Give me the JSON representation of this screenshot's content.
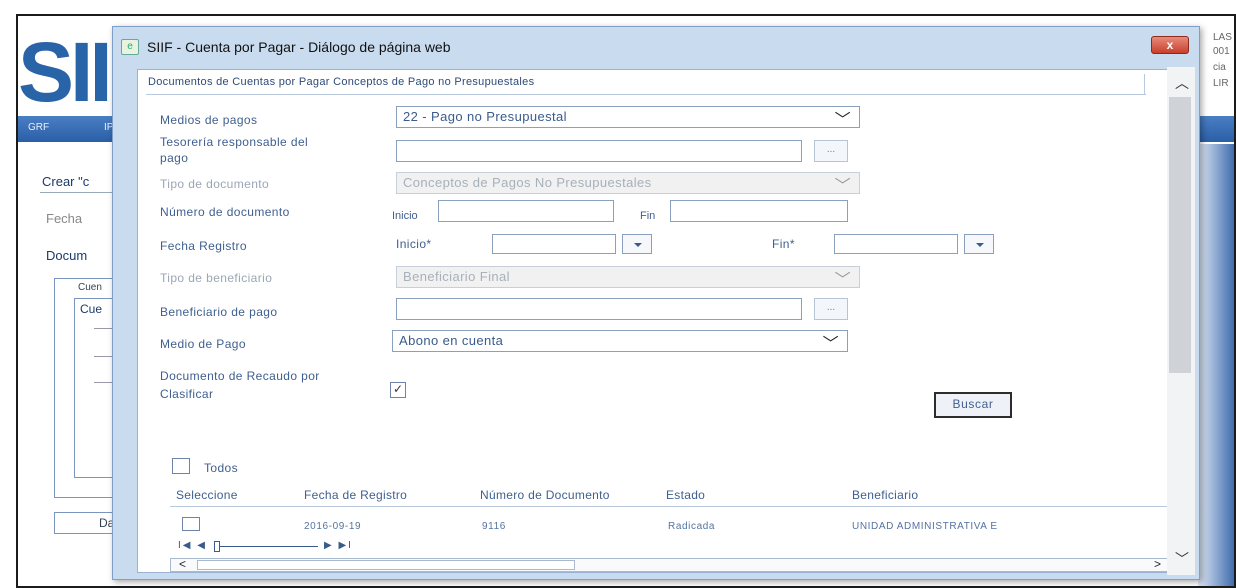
{
  "background": {
    "logo": "SII",
    "nav_items": [
      "GRF",
      "IP"
    ],
    "right_fragments": [
      "LAS",
      "001",
      "cia",
      "LIR"
    ],
    "crear_text": "Crear \"c",
    "fecha_text": "Fecha",
    "docum_text": "Docum",
    "tab_outer": "Cuen",
    "tab_inner": "Cue",
    "dat_button": "Dat"
  },
  "dialog": {
    "title": "SIIF - Cuenta por Pagar - Diálogo de página web",
    "close_label": "x",
    "panel_title": "Documentos de Cuentas por Pagar Conceptos de Pago no Presupuestales",
    "form": {
      "medios_pagos_label": "Medios de pagos",
      "medios_pagos_value": "22 - Pago no Presupuestal",
      "tesoreria_label_1": "Tesorería responsable del",
      "tesoreria_label_2": "pago",
      "ellipsis": "...",
      "tipo_doc_label": "Tipo de documento",
      "tipo_doc_value": "Conceptos de Pagos No Presupuestales",
      "num_doc_label": "Número de documento",
      "inicio_label": "Inicio",
      "fin_label": "Fin",
      "fecha_registro_label": "Fecha Registro",
      "fecha_inicio_label": "Inicio*",
      "fecha_fin_label": "Fin*",
      "tipo_benef_label": "Tipo de beneficiario",
      "tipo_benef_value": "Beneficiario Final",
      "benef_pago_label": "Beneficiario de pago",
      "medio_pago_label": "Medio de Pago",
      "medio_pago_value": "Abono en cuenta",
      "doc_recaudo_label_1": "Documento de Recaudo por",
      "doc_recaudo_label_2": "Clasificar",
      "doc_recaudo_checked": "✓",
      "buscar_label": "Buscar"
    },
    "table": {
      "todos_label": "Todos",
      "headers": [
        "Seleccione",
        "Fecha de Registro",
        "Número de Documento",
        "Estado",
        "Beneficiario"
      ],
      "rows": [
        {
          "fecha": "2016-09-19",
          "numero": "9116",
          "estado": "Radicada",
          "beneficiario": "UNIDAD ADMINISTRATIVA E"
        }
      ],
      "pager_prev": "I◀ ◀",
      "pager_next": "▶ ▶I"
    },
    "scroll": {
      "left": "<",
      "right": ">",
      "up": "︿",
      "down": "﹀"
    }
  }
}
